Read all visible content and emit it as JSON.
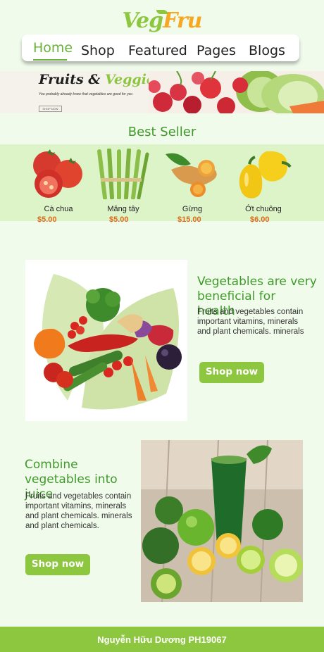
{
  "logo": {
    "part1": "Veg",
    "part2": "Fru"
  },
  "nav": {
    "items": [
      {
        "label": "Home",
        "active": true
      },
      {
        "label": "Shop"
      },
      {
        "label": "Featured"
      },
      {
        "label": "Pages"
      },
      {
        "label": "Blogs"
      }
    ]
  },
  "banner": {
    "title_part1": "Fruits & ",
    "title_part2": "Veggies",
    "subtitle": "You probably already know that vegetables are good for you",
    "button_label": "SHOP NOW"
  },
  "bestseller": {
    "title": "Best Seller",
    "products": [
      {
        "name": "Cà chua",
        "price": "$5.00",
        "icon": "tomato-icon"
      },
      {
        "name": "Măng tây",
        "price": "$5.00",
        "icon": "asparagus-icon"
      },
      {
        "name": "Gừng",
        "price": "$15.00",
        "icon": "ginger-icon"
      },
      {
        "name": "Ớt chuông",
        "price": "$6.00",
        "icon": "bell-pepper-icon"
      }
    ]
  },
  "feature1": {
    "title": "Vegetables are very beneficial for health",
    "text": "Fruits and vegetables contain important vitamins, minerals and plant chemicals.  minerals",
    "button_label": "Shop now"
  },
  "feature2": {
    "title": "Combine vegetables into juice",
    "text": "Fruits and vegetables contain important vitamins, minerals and plant chemicals.  minerals and plant chemicals.",
    "button_label": "Shop now"
  },
  "footer": {
    "text": "Nguyễn Hữu Dương PH19067"
  },
  "colors": {
    "accent": "#8dc63f",
    "title_green": "#3f9a2a",
    "price": "#e06a1b",
    "logo_orange": "#f7a823"
  }
}
